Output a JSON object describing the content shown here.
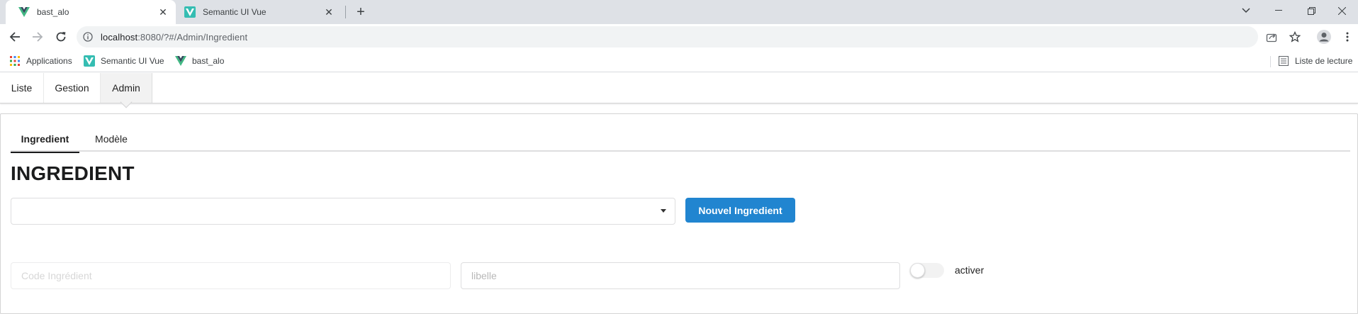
{
  "browser": {
    "tabs": [
      {
        "title": "bast_alo",
        "active": true
      },
      {
        "title": "Semantic UI Vue",
        "active": false
      }
    ],
    "address": {
      "host": "localhost",
      "path": ":8080/?#/Admin/Ingredient"
    },
    "bookmarks": [
      {
        "label": "Applications"
      },
      {
        "label": "Semantic UI Vue"
      },
      {
        "label": "bast_alo"
      }
    ],
    "reading_list": "Liste de lecture"
  },
  "app": {
    "menu": [
      {
        "label": "Liste"
      },
      {
        "label": "Gestion"
      },
      {
        "label": "Admin"
      }
    ],
    "sub_tabs": [
      {
        "label": "Ingredient"
      },
      {
        "label": "Modèle"
      }
    ],
    "page_title": "INGREDIENT",
    "dropdown_value": "",
    "new_button": "Nouvel Ingredient",
    "form": {
      "code_placeholder": "Code Ingrédient",
      "libelle_placeholder": "libelle",
      "toggle_label": "activer"
    }
  },
  "colors": {
    "primary": "#2185d0",
    "vue_green": "#41b883",
    "vue_dark": "#35495e"
  }
}
